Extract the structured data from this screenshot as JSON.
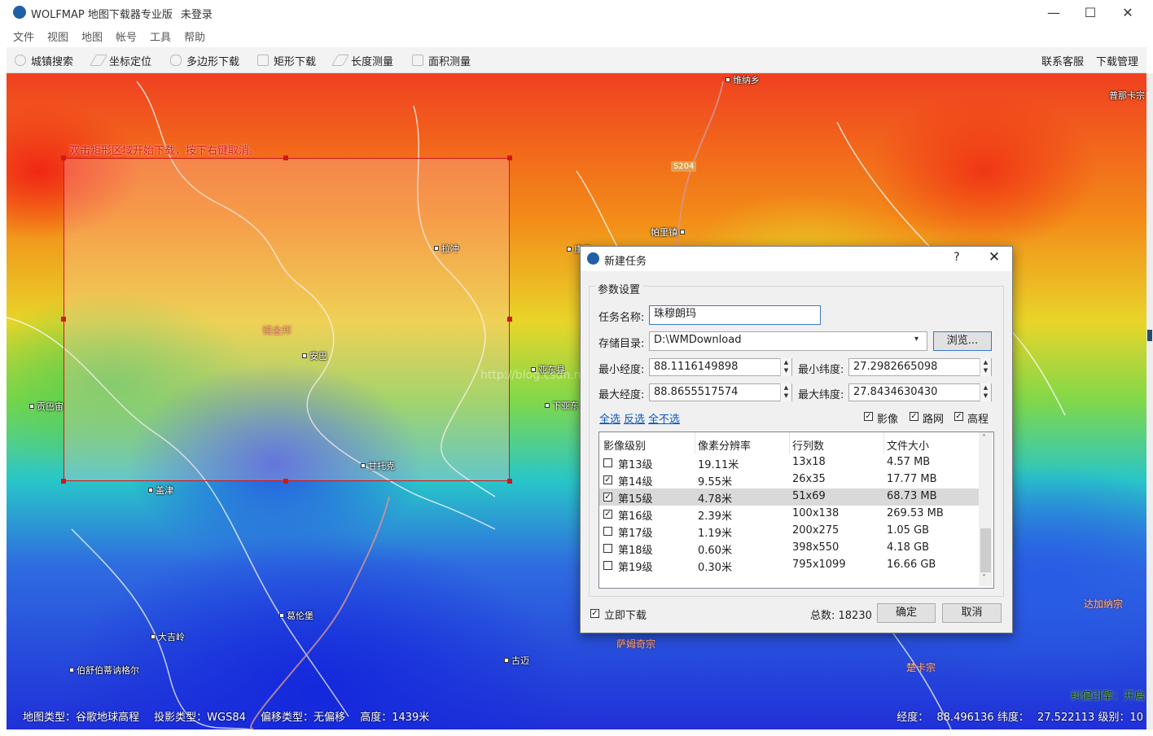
{
  "window": {
    "title": "WOLFMAP 地图下载器专业版",
    "login_status": "未登录",
    "minimize": "—",
    "maximize": "☐",
    "close": "✕"
  },
  "menu": [
    "文件",
    "视图",
    "地图",
    "帐号",
    "工具",
    "帮助"
  ],
  "toolbar": {
    "tools": [
      "城镇搜索",
      "坐标定位",
      "多边形下载",
      "矩形下载",
      "长度测量",
      "面积测量"
    ],
    "right": [
      "联系客服",
      "下载管理"
    ]
  },
  "map": {
    "hint": "双击矩形区域开始下载，按下右键取消。",
    "road_label": "S204",
    "watermark": "http://blog.csdn.net/wolfmap",
    "places": [
      "维纳乡",
      "普那卡宗",
      "帕里镇",
      "康马",
      "拉冲",
      "锡金邦",
      "安巴",
      "亚东县",
      "下亚东",
      "贡巴宙",
      "甘托克",
      "盖津",
      "葛伦堡",
      "大吉岭",
      "伯舒伯蒂讷格尔",
      "古迈",
      "萨姆奇宗",
      "达加纳宗",
      "楚卡宗"
    ],
    "engine_status": "纠偏引擎：开启",
    "status": {
      "map_type": "地图类型：谷歌地球高程",
      "projection": "投影类型：WGS84",
      "offset": "偏移类型：无偏移",
      "altitude": "高度：1439米"
    },
    "coords": {
      "lon_label": "经度：",
      "lon": "88.496136",
      "lat_label": "纬度：",
      "lat": "27.522113",
      "level": "级别：10"
    }
  },
  "dialog": {
    "title": "新建任务",
    "help": "?",
    "close": "✕",
    "group_label": "参数设置",
    "task_name_label": "任务名称:",
    "task_name": "珠穆朗玛",
    "storage_label": "存储目录:",
    "storage_dir": "D:\\WMDownload",
    "browse_button": "浏览...",
    "min_lon_label": "最小经度:",
    "min_lon": "88.1116149898",
    "min_lat_label": "最小纬度:",
    "min_lat": "27.2982665098",
    "max_lon_label": "最大经度:",
    "max_lon": "88.8655517574",
    "max_lat_label": "最大纬度:",
    "max_lat": "27.8434630430",
    "select_all": "全选",
    "invert": "反选",
    "select_none": "全不选",
    "layers": [
      {
        "label": "影像",
        "checked": true
      },
      {
        "label": "路网",
        "checked": true
      },
      {
        "label": "高程",
        "checked": true
      }
    ],
    "table": {
      "headers": [
        "影像级别",
        "像素分辨率",
        "行列数",
        "文件大小"
      ],
      "rows": [
        {
          "level": "第13级",
          "res": "19.11米",
          "grid": "13x18",
          "size": "4.57 MB",
          "checked": false
        },
        {
          "level": "第14级",
          "res": "9.55米",
          "grid": "26x35",
          "size": "17.77 MB",
          "checked": true
        },
        {
          "level": "第15级",
          "res": "4.78米",
          "grid": "51x69",
          "size": "68.73 MB",
          "checked": true,
          "selected": true
        },
        {
          "level": "第16级",
          "res": "2.39米",
          "grid": "100x138",
          "size": "269.53 MB",
          "checked": true
        },
        {
          "level": "第17级",
          "res": "1.19米",
          "grid": "200x275",
          "size": "1.05 GB",
          "checked": false
        },
        {
          "level": "第18级",
          "res": "0.60米",
          "grid": "398x550",
          "size": "4.18 GB",
          "checked": false
        },
        {
          "level": "第19级",
          "res": "0.30米",
          "grid": "795x1099",
          "size": "16.66 GB",
          "checked": false
        }
      ]
    },
    "immediate_label": "立即下载",
    "immediate_checked": true,
    "total": "总数: 18230",
    "ok_button": "确定",
    "cancel_button": "取消"
  }
}
